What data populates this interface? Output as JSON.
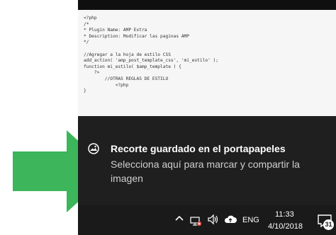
{
  "code_snippet": "<?php\n/*\n* Plugin Name: AMP Extra\n* Description: Modificar las paginas AMP\n*/\n\n//Agregar a la hoja de estilo CSS\nadd_action( 'amp_post_template_css', 'mi_estilo' );\nfunction mi_estilo( $amp_template ) {\n    ?>\n        //OTRAS REGLAS DE ESTILO\n            <?php\n}",
  "toast": {
    "title": "Recorte guardado en el portapapeles",
    "body": "Selecciona aquí para marcar y compartir la imagen",
    "icon": "image-icon"
  },
  "taskbar": {
    "language": "ENG",
    "time": "11:33",
    "date": "4/10/2018",
    "notification_count": "31",
    "tray_icons": [
      "chevron-up-icon",
      "network-icon",
      "volume-icon",
      "cloud-icon",
      "notification-icon"
    ]
  },
  "colors": {
    "arrow": "#3cb55b",
    "panel": "#1f1f1f",
    "taskbar": "#1a1a1a"
  }
}
